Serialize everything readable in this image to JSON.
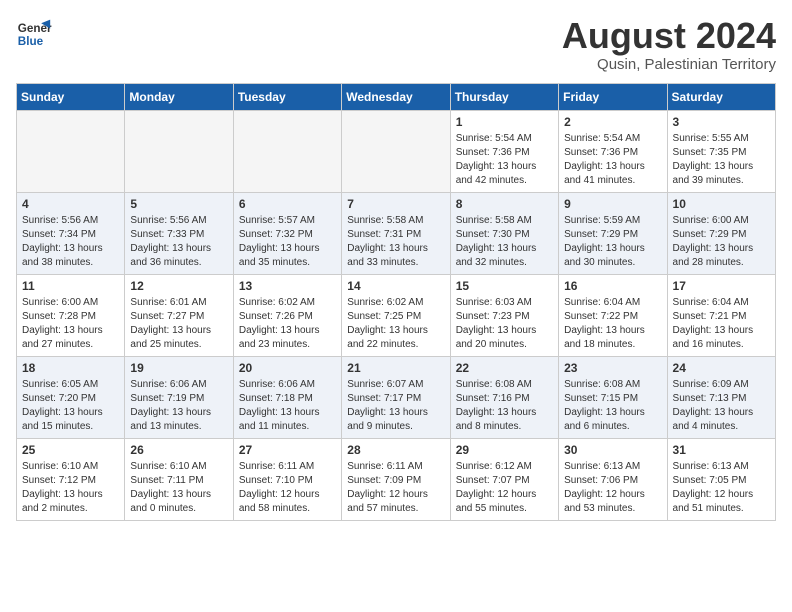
{
  "logo": {
    "line1": "General",
    "line2": "Blue"
  },
  "title": "August 2024",
  "subtitle": "Qusin, Palestinian Territory",
  "days_header": [
    "Sunday",
    "Monday",
    "Tuesday",
    "Wednesday",
    "Thursday",
    "Friday",
    "Saturday"
  ],
  "weeks": [
    [
      {
        "day": "",
        "info": ""
      },
      {
        "day": "",
        "info": ""
      },
      {
        "day": "",
        "info": ""
      },
      {
        "day": "",
        "info": ""
      },
      {
        "day": "1",
        "info": "Sunrise: 5:54 AM\nSunset: 7:36 PM\nDaylight: 13 hours\nand 42 minutes."
      },
      {
        "day": "2",
        "info": "Sunrise: 5:54 AM\nSunset: 7:36 PM\nDaylight: 13 hours\nand 41 minutes."
      },
      {
        "day": "3",
        "info": "Sunrise: 5:55 AM\nSunset: 7:35 PM\nDaylight: 13 hours\nand 39 minutes."
      }
    ],
    [
      {
        "day": "4",
        "info": "Sunrise: 5:56 AM\nSunset: 7:34 PM\nDaylight: 13 hours\nand 38 minutes."
      },
      {
        "day": "5",
        "info": "Sunrise: 5:56 AM\nSunset: 7:33 PM\nDaylight: 13 hours\nand 36 minutes."
      },
      {
        "day": "6",
        "info": "Sunrise: 5:57 AM\nSunset: 7:32 PM\nDaylight: 13 hours\nand 35 minutes."
      },
      {
        "day": "7",
        "info": "Sunrise: 5:58 AM\nSunset: 7:31 PM\nDaylight: 13 hours\nand 33 minutes."
      },
      {
        "day": "8",
        "info": "Sunrise: 5:58 AM\nSunset: 7:30 PM\nDaylight: 13 hours\nand 32 minutes."
      },
      {
        "day": "9",
        "info": "Sunrise: 5:59 AM\nSunset: 7:29 PM\nDaylight: 13 hours\nand 30 minutes."
      },
      {
        "day": "10",
        "info": "Sunrise: 6:00 AM\nSunset: 7:29 PM\nDaylight: 13 hours\nand 28 minutes."
      }
    ],
    [
      {
        "day": "11",
        "info": "Sunrise: 6:00 AM\nSunset: 7:28 PM\nDaylight: 13 hours\nand 27 minutes."
      },
      {
        "day": "12",
        "info": "Sunrise: 6:01 AM\nSunset: 7:27 PM\nDaylight: 13 hours\nand 25 minutes."
      },
      {
        "day": "13",
        "info": "Sunrise: 6:02 AM\nSunset: 7:26 PM\nDaylight: 13 hours\nand 23 minutes."
      },
      {
        "day": "14",
        "info": "Sunrise: 6:02 AM\nSunset: 7:25 PM\nDaylight: 13 hours\nand 22 minutes."
      },
      {
        "day": "15",
        "info": "Sunrise: 6:03 AM\nSunset: 7:23 PM\nDaylight: 13 hours\nand 20 minutes."
      },
      {
        "day": "16",
        "info": "Sunrise: 6:04 AM\nSunset: 7:22 PM\nDaylight: 13 hours\nand 18 minutes."
      },
      {
        "day": "17",
        "info": "Sunrise: 6:04 AM\nSunset: 7:21 PM\nDaylight: 13 hours\nand 16 minutes."
      }
    ],
    [
      {
        "day": "18",
        "info": "Sunrise: 6:05 AM\nSunset: 7:20 PM\nDaylight: 13 hours\nand 15 minutes."
      },
      {
        "day": "19",
        "info": "Sunrise: 6:06 AM\nSunset: 7:19 PM\nDaylight: 13 hours\nand 13 minutes."
      },
      {
        "day": "20",
        "info": "Sunrise: 6:06 AM\nSunset: 7:18 PM\nDaylight: 13 hours\nand 11 minutes."
      },
      {
        "day": "21",
        "info": "Sunrise: 6:07 AM\nSunset: 7:17 PM\nDaylight: 13 hours\nand 9 minutes."
      },
      {
        "day": "22",
        "info": "Sunrise: 6:08 AM\nSunset: 7:16 PM\nDaylight: 13 hours\nand 8 minutes."
      },
      {
        "day": "23",
        "info": "Sunrise: 6:08 AM\nSunset: 7:15 PM\nDaylight: 13 hours\nand 6 minutes."
      },
      {
        "day": "24",
        "info": "Sunrise: 6:09 AM\nSunset: 7:13 PM\nDaylight: 13 hours\nand 4 minutes."
      }
    ],
    [
      {
        "day": "25",
        "info": "Sunrise: 6:10 AM\nSunset: 7:12 PM\nDaylight: 13 hours\nand 2 minutes."
      },
      {
        "day": "26",
        "info": "Sunrise: 6:10 AM\nSunset: 7:11 PM\nDaylight: 13 hours\nand 0 minutes."
      },
      {
        "day": "27",
        "info": "Sunrise: 6:11 AM\nSunset: 7:10 PM\nDaylight: 12 hours\nand 58 minutes."
      },
      {
        "day": "28",
        "info": "Sunrise: 6:11 AM\nSunset: 7:09 PM\nDaylight: 12 hours\nand 57 minutes."
      },
      {
        "day": "29",
        "info": "Sunrise: 6:12 AM\nSunset: 7:07 PM\nDaylight: 12 hours\nand 55 minutes."
      },
      {
        "day": "30",
        "info": "Sunrise: 6:13 AM\nSunset: 7:06 PM\nDaylight: 12 hours\nand 53 minutes."
      },
      {
        "day": "31",
        "info": "Sunrise: 6:13 AM\nSunset: 7:05 PM\nDaylight: 12 hours\nand 51 minutes."
      }
    ]
  ]
}
